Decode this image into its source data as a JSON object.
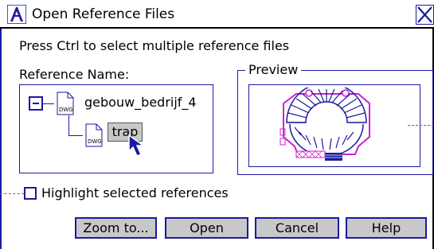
{
  "window": {
    "title": "Open Reference Files",
    "close_glyph": "X",
    "app_icon": "autocad-a-icon"
  },
  "instruction": "Press Ctrl to select multiple reference files",
  "reference": {
    "label": "Reference Name:",
    "tree": [
      {
        "name": "gebouw_bedrijf_4",
        "icon": "dwg-file-icon",
        "file_type": "DWG",
        "expanded": true
      },
      {
        "name": "trap",
        "icon": "dwg-file-icon",
        "file_type": "DWG",
        "selected": true
      }
    ]
  },
  "preview": {
    "label": "Preview"
  },
  "highlight": {
    "label": "Highlight selected references",
    "checked": false
  },
  "buttons": {
    "zoom": "Zoom to...",
    "open": "Open",
    "cancel": "Cancel",
    "help": "Help"
  },
  "colors": {
    "accent": "#1a1aa0",
    "selection": "#c8c8c8",
    "dash": "#e03040",
    "preview_magenta": "#d020d0"
  }
}
